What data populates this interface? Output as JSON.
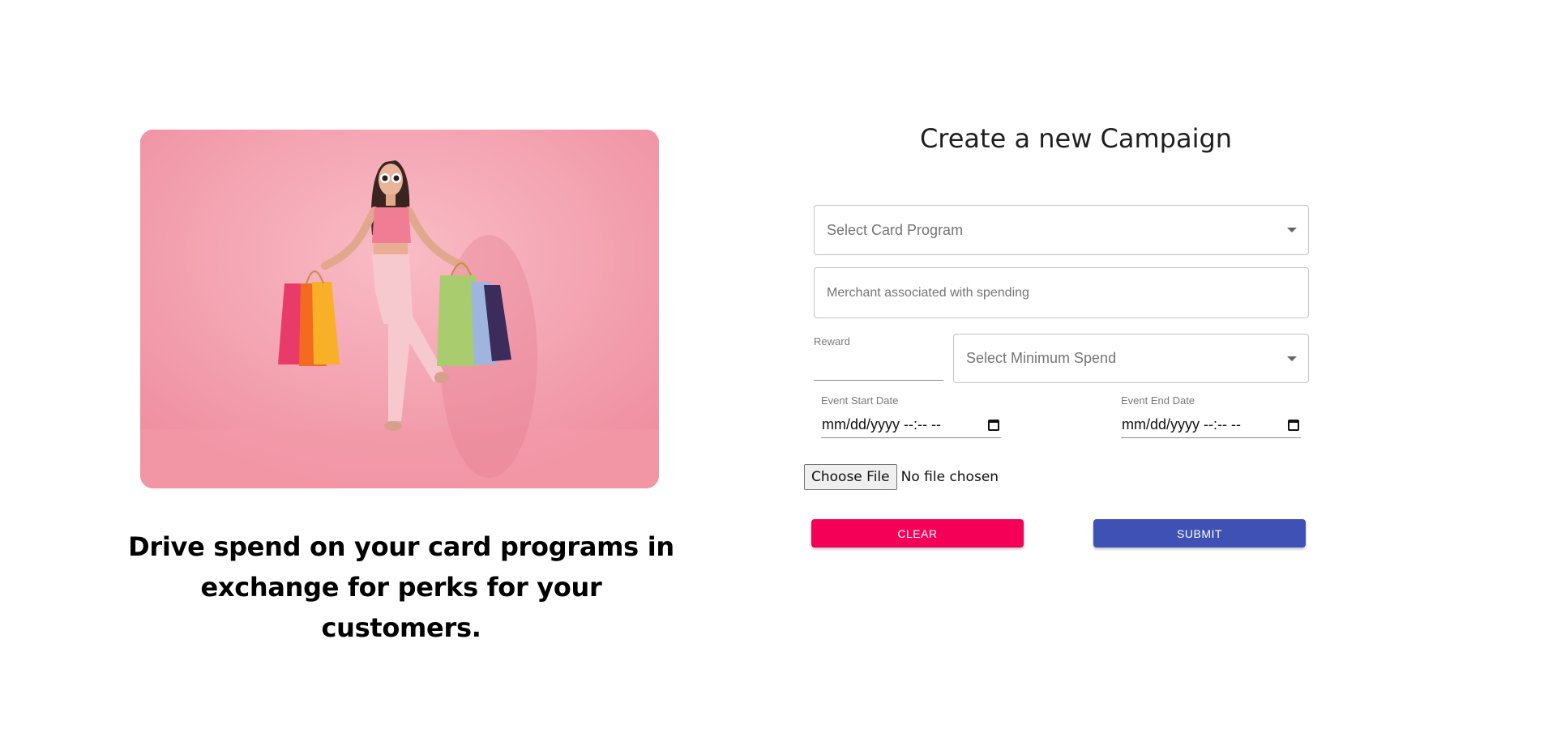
{
  "promo": {
    "image_description_icon": "shopping-woman-image",
    "tagline_line1": "Drive spend on your card programs in",
    "tagline_line2": "exchange for perks for your customers."
  },
  "form": {
    "title": "Create a new Campaign",
    "card_program": {
      "placeholder": "Select Card Program",
      "icon": "chevron-down-icon"
    },
    "merchant": {
      "placeholder": "Merchant associated with spending"
    },
    "reward": {
      "label": "Reward",
      "value": ""
    },
    "min_spend": {
      "placeholder": "Select Minimum Spend",
      "icon": "chevron-down-icon"
    },
    "start_date": {
      "label": "Event Start Date",
      "value": "mm/dd/yyyy --:-- --",
      "icon": "calendar-icon"
    },
    "end_date": {
      "label": "Event End Date",
      "value": "mm/dd/yyyy --:-- --",
      "icon": "calendar-icon"
    },
    "file": {
      "button_label": "Choose File",
      "status": "No file chosen"
    },
    "clear_label": "CLEAR",
    "submit_label": "SUBMIT"
  },
  "colors": {
    "clear_button": "#f50057",
    "submit_button": "#3f51b5",
    "hero_background": "#f5a2b0"
  }
}
